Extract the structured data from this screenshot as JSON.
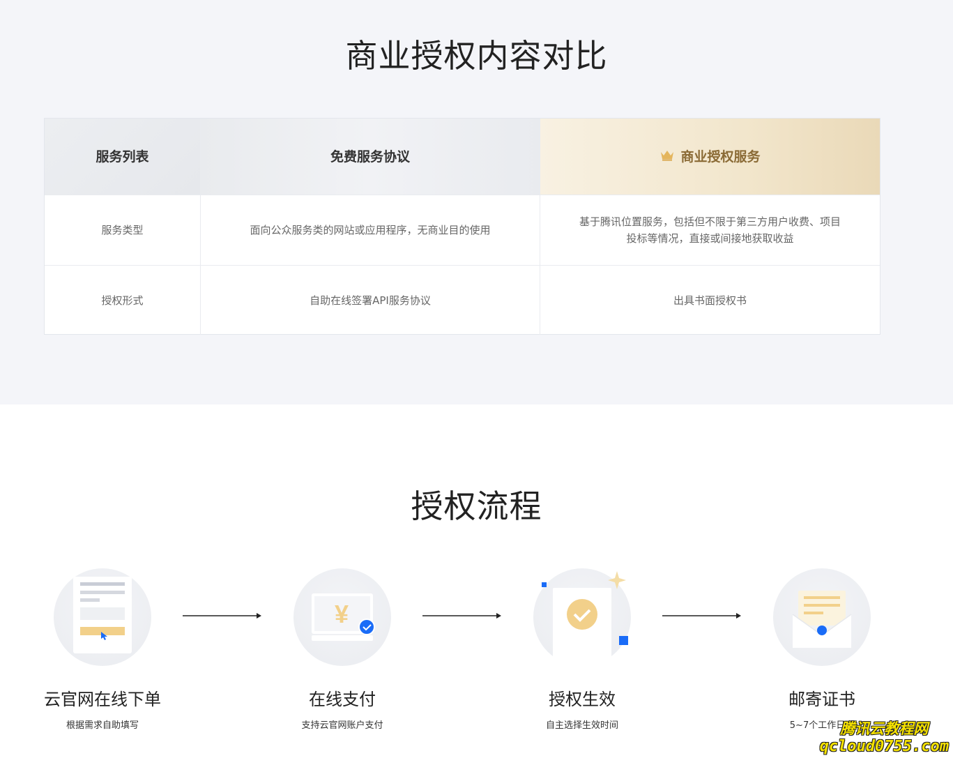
{
  "compare": {
    "title": "商业授权内容对比",
    "headers": [
      "服务列表",
      "免费服务协议",
      "商业授权服务"
    ],
    "rows": [
      [
        "服务类型",
        "面向公众服务类的网站或应用程序，无商业目的使用",
        "基于腾讯位置服务，包括但不限于第三方用户收费、项目投标等情况，直接或间接地获取收益"
      ],
      [
        "授权形式",
        "自助在线签署API服务协议",
        "出具书面授权书"
      ]
    ],
    "premium_icon": "crown-icon",
    "colors": {
      "accent_blue": "#1a6cf7",
      "gold": "#f2d08a",
      "premium_text": "#8a6a35"
    }
  },
  "flow": {
    "title": "授权流程",
    "steps": [
      {
        "label": "云官网在线下单",
        "desc": "根据需求自助填写",
        "icon": "order-form-icon"
      },
      {
        "label": "在线支付",
        "desc": "支持云官网账户支付",
        "icon": "payment-icon"
      },
      {
        "label": "授权生效",
        "desc": "自主选择生效时间",
        "icon": "certificate-check-icon"
      },
      {
        "label": "邮寄证书",
        "desc": "5~7个工作日完",
        "icon": "mail-envelope-icon"
      }
    ]
  },
  "watermark": {
    "line1": "腾讯云教程网",
    "line2": "qcloud0755.com"
  }
}
